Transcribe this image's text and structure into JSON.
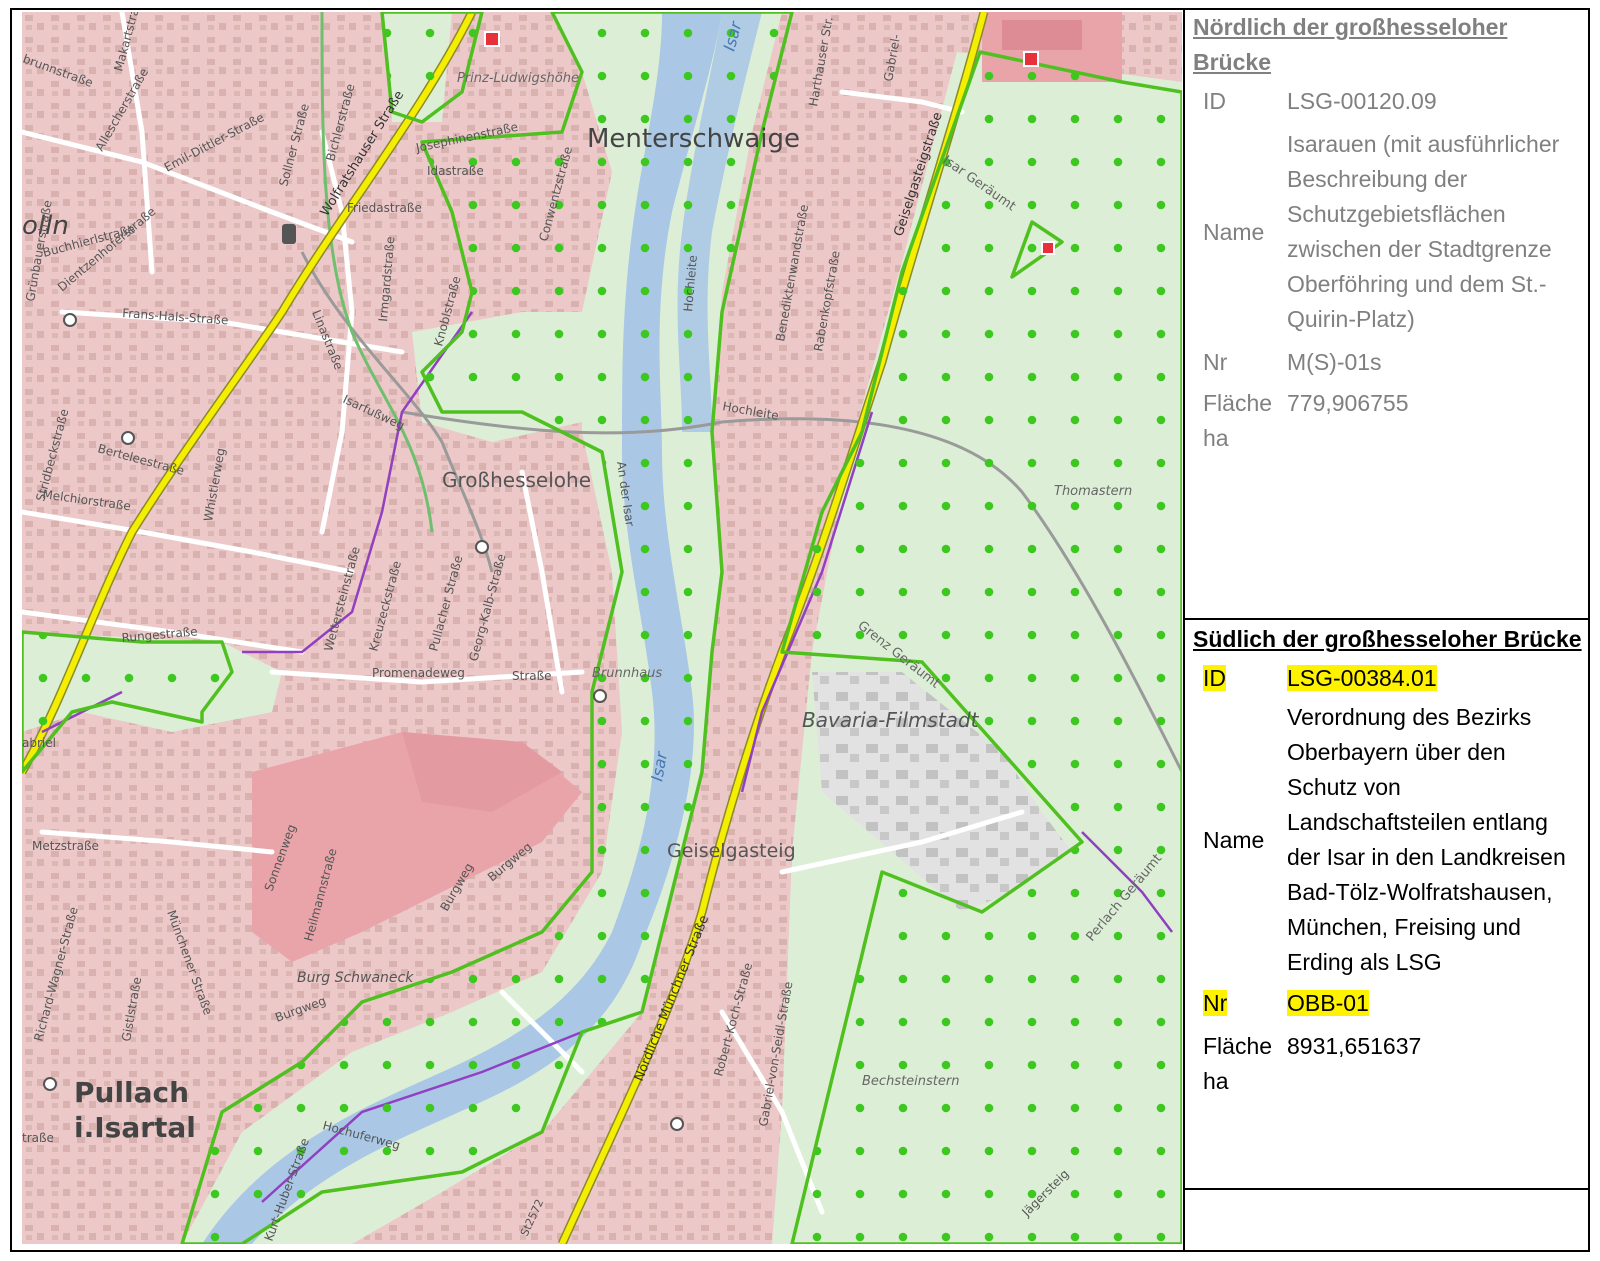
{
  "map": {
    "labels": {
      "menterschwaige": "Menterschwaige",
      "prinz_ludwigshoehe": "Prinz-Ludwigshöhe",
      "grosshesselohe": "Großhesselohe",
      "bavaria": "Bavaria-Filmstadt",
      "geiselgasteig": "Geiselgasteig",
      "pullach1": "Pullach",
      "pullach2": "i.Isartal",
      "solln": "olln",
      "thomastern": "Thomastern",
      "bechsteinstern": "Bechsteinstern",
      "brunnhaus": "Brunnhaus",
      "burg_schwaneck": "Burg Schwaneck",
      "isar1": "Isar",
      "isar2": "Isar",
      "isar_geraeumt": "Isar Geräumt",
      "grenz_geraeumt": "Grenz Geräumt",
      "perlach_geraeumt": "Perlach Geräumt",
      "wolfratshauser": "Wolfratshauser Straße",
      "muenchner": "Nördliche Münchner Straße",
      "geiselgasteigstr": "Geiselgasteigstraße",
      "emil_dittler": "Emil-Dittler-Straße",
      "makartstr": "Makartstraße",
      "brunnstr": "brunnstraße",
      "allescherstr": "Allescherstraße",
      "bichlerstr": "Bichlerstraße",
      "sollner": "Sollner Straße",
      "josephinen": "Josephinenstraße",
      "idastr": "Idastraße",
      "friedastr": "Friedastraße",
      "buchhierl": "Buchhierlstraße",
      "dientzenhofer": "Dientzenhoferstraße",
      "gruenbauer": "Grünbauerstraße",
      "frans_hals": "Frans-Hals-Straße",
      "irmgard": "Irmgardstraße",
      "knoebel": "Knoblstraße",
      "linastr": "Linastraße",
      "isarfussweg": "Isarfußweg",
      "berteles": "Berteleestraße",
      "stridbeck": "Stridbeckstraße",
      "melchior": "Melchiorstraße",
      "whistler": "Whistlerweg",
      "wettersteinstr": "Wettersteinstraße",
      "kreuzeck": "Kreuzeckstraße",
      "pullacher": "Pullacher Straße",
      "georg_kalb": "Georg-Kalb-Straße",
      "runge": "Rungestraße",
      "promenade": "Promenadeweg",
      "strasse": "Straße",
      "an_der_isar": "An der Isar",
      "conwentz": "Conwentzstraße",
      "hochleite": "Hochleite",
      "hochleite2": "Hochleite",
      "benediktenwand": "Benediktenwandstraße",
      "rabenkopf": "Rabenkopfstraße",
      "harthauser": "Harthauser Str.",
      "gabriel": "Gabriel-",
      "metzstr": "Metzstraße",
      "sonnenweg": "Sonnenweg",
      "heilmann": "Heilmannstraße",
      "burgweg": "Burgweg",
      "burgweg2": "Burgweg",
      "burgweg3": "Burgweg",
      "muenchener": "Münchener Straße",
      "richard_wagner": "Richard-Wagner-Straße",
      "gistlstr": "Gistlstraße",
      "robert_koch": "Robert-Koch-Straße",
      "gabriel_seidl": "Gabriel-von-Seidl-Straße",
      "hochuferweg": "Hochuferweg",
      "kurt_huber": "Kurt-Huber-Straße",
      "gabriel2": "abriel",
      "strasse2": "traße",
      "st2572": "St2572",
      "jaegersteig": "Jägersteig"
    }
  },
  "north": {
    "heading": "Nördlich der großhesseloher Brücke",
    "rows": [
      {
        "key": "ID",
        "value": "LSG-00120.09"
      },
      {
        "key": "Name",
        "value": "Isarauen (mit ausführlicher Beschreibung der Schutzgebietsflächen zwischen der Stadtgrenze Oberföhring und dem St.-Quirin-Platz)"
      },
      {
        "key": "Nr",
        "value": "M(S)-01s"
      },
      {
        "key": "Fläche ha",
        "value": "779,906755"
      }
    ]
  },
  "south": {
    "heading": "Südlich der großhesseloher Brücke",
    "rows": [
      {
        "key": "ID",
        "value": "LSG-00384.01",
        "highlight": true
      },
      {
        "key": "Name",
        "value": "Verordnung des Bezirks Oberbayern über den Schutz von Landschaftsteilen entlang der Isar in den Landkreisen Bad-Tölz-Wolfratshausen, München, Freising und Erding als LSG",
        "highlight": false
      },
      {
        "key": "Nr",
        "value": "OBB-01",
        "highlight": true
      },
      {
        "key": "Fläche ha",
        "value": "8931,651637",
        "highlight": false
      }
    ]
  },
  "colors": {
    "settlement": "#ecc8c8",
    "forest": "#dcefd6",
    "water": "#aac8e6",
    "boundary": "#4fc020",
    "dots": "#3cc81e",
    "highway": "#f5ee00",
    "highlight": "#fff200"
  }
}
